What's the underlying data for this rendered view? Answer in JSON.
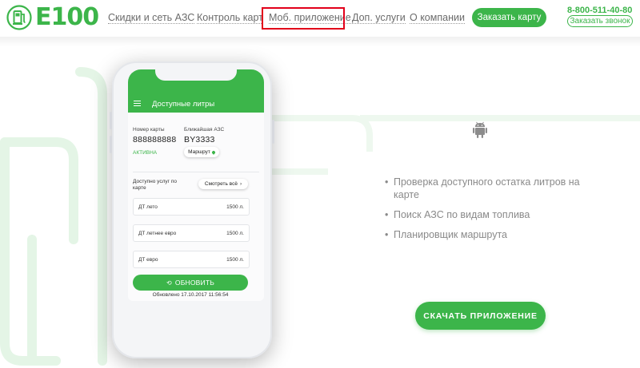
{
  "colors": {
    "brand_green": "#3cb54a",
    "highlight_red": "#e2001a"
  },
  "header": {
    "logo_text": "E100",
    "nav": [
      {
        "label": "Скидки и сеть АЗС"
      },
      {
        "label": "Контроль карт"
      },
      {
        "label": "Моб. приложение",
        "highlighted": true
      },
      {
        "label": "Доп. услуги"
      },
      {
        "label": "О компании"
      }
    ],
    "order_card_label": "Заказать карту",
    "phone": "8-800-511-40-80",
    "callback_label": "Заказать звонок"
  },
  "app_mockup": {
    "title": "Доступные литры",
    "card_number_label": "Номер карты",
    "card_number": "888888888",
    "card_status": "АКТИВНА",
    "nearest_station_label": "Ближайшая АЗС",
    "nearest_station": "BY3333",
    "route_label": "Маршрут",
    "services_label": "Доступно услуг по карте",
    "see_all_label": "Смотреть всё",
    "fuel": [
      {
        "name": "ДТ лето",
        "amount": "1500 л."
      },
      {
        "name": "ДТ летнее евро",
        "amount": "1500 л."
      },
      {
        "name": "ДТ евро",
        "amount": "1500 л."
      }
    ],
    "refresh_label": "ОБНОВИТЬ",
    "updated_text": "Обновлено 17.10.2017 11:56:54"
  },
  "features": [
    "Проверка доступного остатка литров на карте",
    "Поиск АЗС по видам топлива",
    "Планировщик маршрута"
  ],
  "download_label": "СКАЧАТЬ ПРИЛОЖЕНИЕ",
  "icons": {
    "platform": "android-icon",
    "menu": "hamburger-menu-icon",
    "route": "map-pin-icon",
    "refresh": "refresh-icon"
  }
}
